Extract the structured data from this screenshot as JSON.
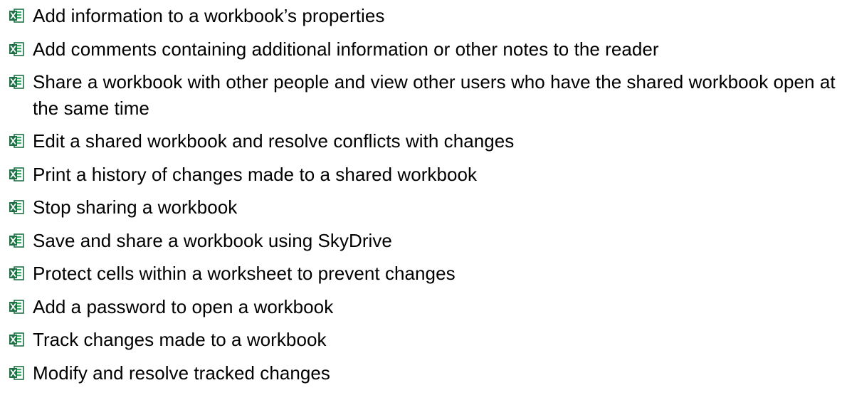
{
  "bullet_icon": "excel-icon",
  "colors": {
    "icon_dark_green": "#1e7145",
    "icon_light_green": "#38b06a",
    "text": "#000000"
  },
  "items": [
    {
      "text": "Add information to a workbook’s properties"
    },
    {
      "text": "Add comments containing additional information or other notes to the reader"
    },
    {
      "text": "Share a workbook with other people and view other users who have the shared workbook open at the same time"
    },
    {
      "text": "Edit a shared workbook and resolve conflicts with changes"
    },
    {
      "text": "Print a history of changes made to a shared workbook"
    },
    {
      "text": "Stop sharing a workbook"
    },
    {
      "text": "Save and share a workbook using SkyDrive"
    },
    {
      "text": "Protect cells within a worksheet to prevent changes"
    },
    {
      "text": "Add a password to open a workbook"
    },
    {
      "text": "Track changes made to a workbook"
    },
    {
      "text": "Modify and resolve tracked changes"
    }
  ]
}
